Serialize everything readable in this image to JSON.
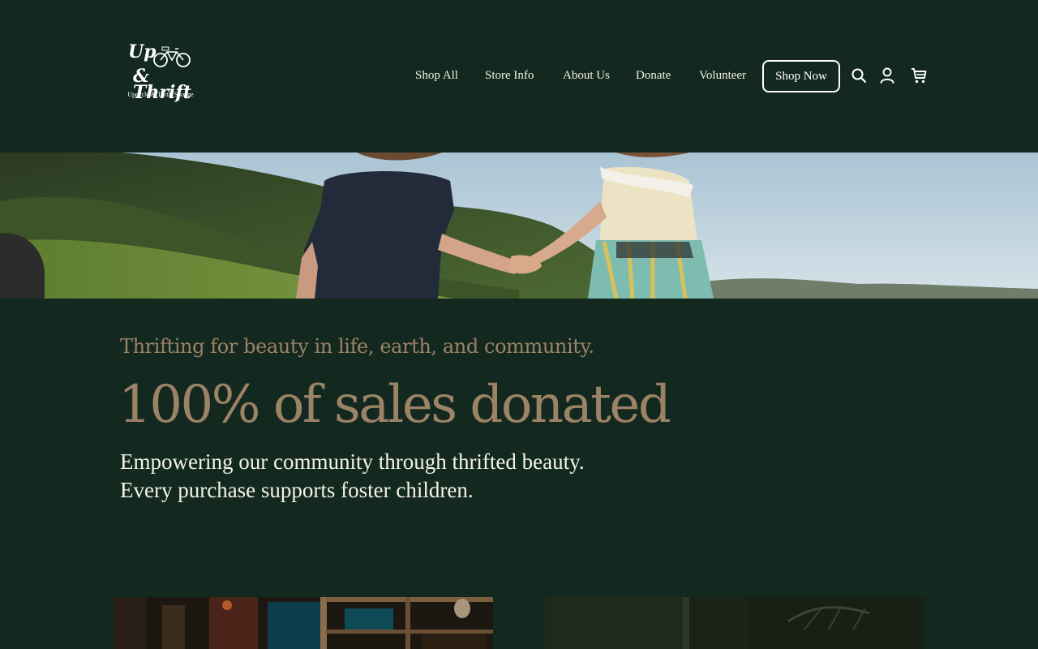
{
  "brand": {
    "logo_line1": "Up",
    "logo_line2": "& Thrift",
    "logo_tagline": "Upcycle & Thrift Shoppe"
  },
  "nav": {
    "items": [
      {
        "label": "Shop All"
      },
      {
        "label": "Store Info"
      },
      {
        "label": "About Us"
      },
      {
        "label": "Donate"
      },
      {
        "label": "Volunteer"
      }
    ],
    "cta_label": "Shop Now",
    "icons": [
      "search-icon",
      "account-icon",
      "cart-icon"
    ]
  },
  "hero": {
    "tagline": "Thrifting for beauty in life, earth, and community.",
    "headline": "100% of sales donated",
    "body_line1": "Empowering our community through thrifted beauty.",
    "body_line2": "Every purchase supports foster children."
  },
  "colors": {
    "background": "#13291f",
    "accent_tan": "#9c8266",
    "text_light": "#f4f1ea"
  }
}
